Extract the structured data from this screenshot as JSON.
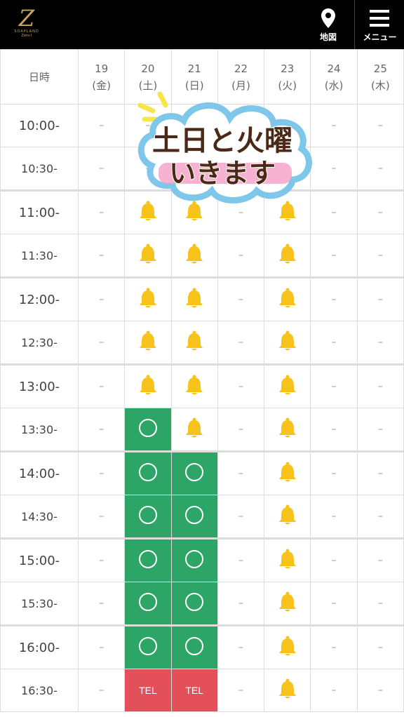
{
  "header": {
    "logo": {
      "mark": "Z",
      "line1": "SOAPLAND",
      "line2": "Zero-I"
    },
    "map_label": "地図",
    "menu_label": "メニュー"
  },
  "table": {
    "corner_label": "日時",
    "days": [
      {
        "num": "19",
        "wd": "(金)",
        "type": "weekday"
      },
      {
        "num": "20",
        "wd": "(土)",
        "type": "sat"
      },
      {
        "num": "21",
        "wd": "(日)",
        "type": "sun"
      },
      {
        "num": "22",
        "wd": "(月)",
        "type": "weekday"
      },
      {
        "num": "23",
        "wd": "(火)",
        "type": "hol"
      },
      {
        "num": "24",
        "wd": "(水)",
        "type": "weekday"
      },
      {
        "num": "25",
        "wd": "(木)",
        "type": "weekday"
      }
    ],
    "rows": [
      {
        "time": "10:00-",
        "cells": [
          "-",
          "-",
          "-",
          "-",
          "-",
          "-",
          "-"
        ]
      },
      {
        "time": "10:30-",
        "cells": [
          "-",
          "-",
          "-",
          "-",
          "-",
          "-",
          "-"
        ]
      },
      {
        "time": "11:00-",
        "cells": [
          "-",
          "bell",
          "bell",
          "-",
          "bell",
          "-",
          "-"
        ]
      },
      {
        "time": "11:30-",
        "cells": [
          "-",
          "bell",
          "bell",
          "-",
          "bell",
          "-",
          "-"
        ]
      },
      {
        "time": "12:00-",
        "cells": [
          "-",
          "bell",
          "bell",
          "-",
          "bell",
          "-",
          "-"
        ]
      },
      {
        "time": "12:30-",
        "cells": [
          "-",
          "bell",
          "bell",
          "-",
          "bell",
          "-",
          "-"
        ]
      },
      {
        "time": "13:00-",
        "cells": [
          "-",
          "bell",
          "bell",
          "-",
          "bell",
          "-",
          "-"
        ]
      },
      {
        "time": "13:30-",
        "cells": [
          "-",
          "ok",
          "bell",
          "-",
          "bell",
          "-",
          "-"
        ]
      },
      {
        "time": "14:00-",
        "cells": [
          "-",
          "ok",
          "ok",
          "-",
          "bell",
          "-",
          "-"
        ]
      },
      {
        "time": "14:30-",
        "cells": [
          "-",
          "ok",
          "ok",
          "-",
          "bell",
          "-",
          "-"
        ]
      },
      {
        "time": "15:00-",
        "cells": [
          "-",
          "ok",
          "ok",
          "-",
          "bell",
          "-",
          "-"
        ]
      },
      {
        "time": "15:30-",
        "cells": [
          "-",
          "ok",
          "ok",
          "-",
          "bell",
          "-",
          "-"
        ]
      },
      {
        "time": "16:00-",
        "cells": [
          "-",
          "ok",
          "ok",
          "-",
          "bell",
          "-",
          "-"
        ]
      },
      {
        "time": "16:30-",
        "cells": [
          "-",
          "tel",
          "tel",
          "-",
          "bell",
          "-",
          "-"
        ]
      }
    ],
    "dash_text": "–",
    "tel_text": "TEL"
  },
  "sticker": {
    "line1": "土日と火曜",
    "line2": "いきます"
  },
  "colors": {
    "header_bg": "#000000",
    "available": "#2ca566",
    "tel": "#e3505a",
    "bell": "#f7c21a",
    "saturday": "#1c3c98",
    "sunday": "#b03030"
  }
}
